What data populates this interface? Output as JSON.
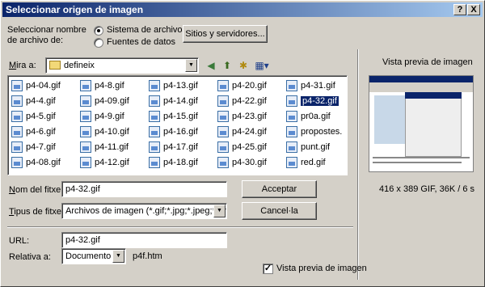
{
  "title": "Seleccionar origen de imagen",
  "title_buttons": {
    "help": "?",
    "close": "X"
  },
  "source": {
    "label": "Seleccionar nombre de archivo de:",
    "option_files": "Sistema de archivos",
    "option_data": "Fuentes de datos",
    "selected": "Sistema de archivos",
    "sites_button": "Sitios y servidores..."
  },
  "lookin": {
    "label": "Mira a:",
    "value": "defineix"
  },
  "files": [
    {
      "name": "p4-04.gif"
    },
    {
      "name": "p4-4.gif"
    },
    {
      "name": "p4-5.gif"
    },
    {
      "name": "p4-6.gif"
    },
    {
      "name": "p4-7.gif"
    },
    {
      "name": "p4-08.gif"
    },
    {
      "name": "p4-8.gif"
    },
    {
      "name": "p4-09.gif"
    },
    {
      "name": "p4-9.gif"
    },
    {
      "name": "p4-10.gif"
    },
    {
      "name": "p4-11.gif"
    },
    {
      "name": "p4-12.gif"
    },
    {
      "name": "p4-13.gif"
    },
    {
      "name": "p4-14.gif"
    },
    {
      "name": "p4-15.gif"
    },
    {
      "name": "p4-16.gif"
    },
    {
      "name": "p4-17.gif"
    },
    {
      "name": "p4-18.gif"
    },
    {
      "name": "p4-20.gif"
    },
    {
      "name": "p4-22.gif"
    },
    {
      "name": "p4-23.gif"
    },
    {
      "name": "p4-24.gif"
    },
    {
      "name": "p4-25.gif"
    },
    {
      "name": "p4-30.gif"
    },
    {
      "name": "p4-31.gif"
    },
    {
      "name": "p4-32.gif",
      "selected": true
    },
    {
      "name": "pr0a.gif"
    },
    {
      "name": "propostes."
    },
    {
      "name": "punt.gif"
    },
    {
      "name": "red.gif"
    }
  ],
  "filename": {
    "label": "Nom del fitxer:",
    "value": "p4-32.gif"
  },
  "filetype": {
    "label": "Tipus de fitxer:",
    "value": "Archivos de imagen (*.gif;*.jpg;*.jpeg;*.png)"
  },
  "buttons": {
    "ok": "Acceptar",
    "cancel": "Cancel·la"
  },
  "url": {
    "label": "URL:",
    "value": "p4-32.gif"
  },
  "relative": {
    "label": "Relativa a:",
    "value": "Documento",
    "file": "p4f.htm"
  },
  "preview": {
    "title": "Vista previa de imagen",
    "info": "416 x 389 GIF, 36K / 6 s",
    "checkbox_label": "Vista previa de imagen",
    "checked": true
  }
}
